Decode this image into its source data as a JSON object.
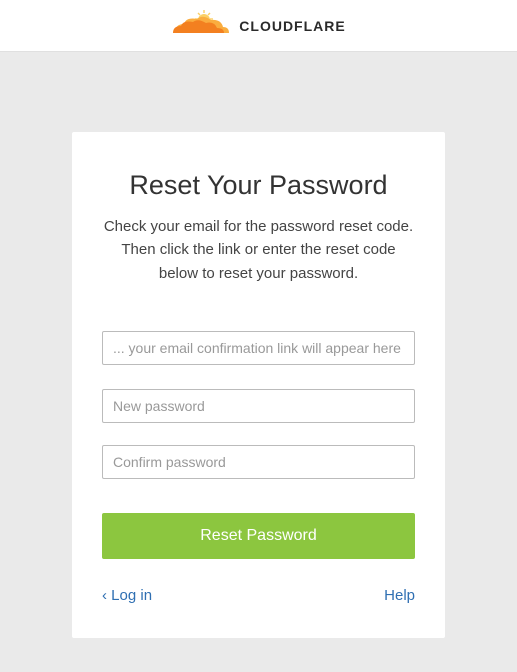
{
  "header": {
    "brand": "CLOUDFLARE"
  },
  "card": {
    "title": "Reset Your Password",
    "subtitle": "Check your email for the password reset code. Then click the link or enter the reset code below to reset your password.",
    "code_placeholder": "... your email confirmation link will appear here",
    "new_password_placeholder": "New password",
    "confirm_password_placeholder": "Confirm password",
    "submit_label": "Reset Password",
    "login_link": "‹ Log in",
    "help_link": "Help"
  },
  "colors": {
    "accent": "#8cc63f",
    "link": "#2f6fb2",
    "cloud_orange": "#f38020",
    "cloud_light": "#faad3f",
    "sun_yellow": "#fbd066"
  }
}
